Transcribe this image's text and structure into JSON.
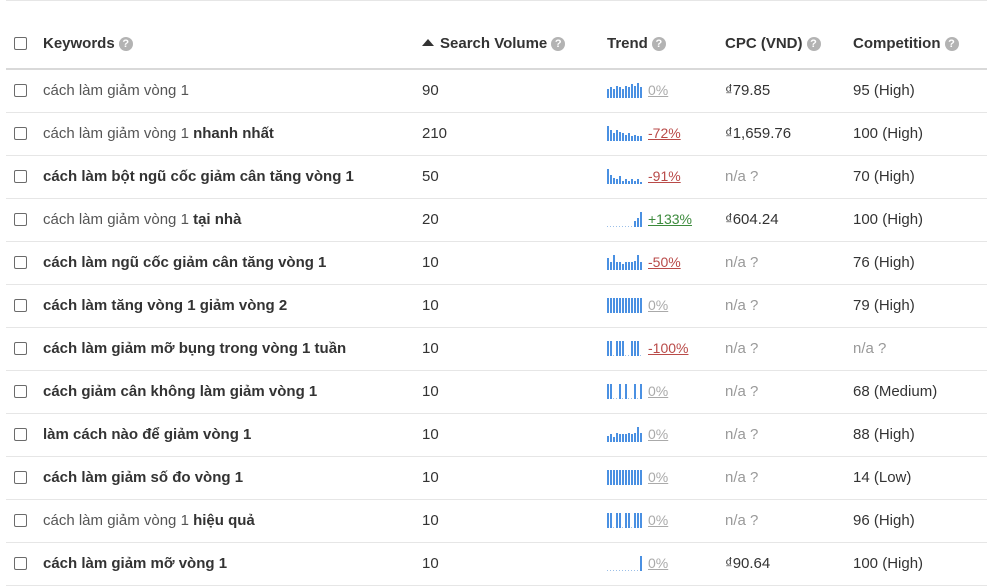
{
  "header": {
    "keywords": "Keywords",
    "search_volume": "Search Volume",
    "trend": "Trend",
    "cpc": "CPC (VND)",
    "competition": "Competition",
    "help_glyph": "?"
  },
  "colors": {
    "spark": "#4a90e2",
    "baseline": "#9bbfe8",
    "negative": "#b94a48",
    "positive": "#3c8a3c"
  },
  "rows": [
    {
      "kw_a": "cách làm giảm vòng 1",
      "kw_b": "",
      "bold_all": false,
      "volume": "90",
      "pct": "0%",
      "pct_kind": "neutral",
      "cpc": "₫79.85",
      "cpc_na": false,
      "comp": "95 (High)",
      "comp_na": false,
      "trend": [
        0.6,
        0.7,
        0.6,
        0.8,
        0.7,
        0.6,
        0.8,
        0.7,
        0.9,
        0.8,
        1.0,
        0.7
      ]
    },
    {
      "kw_a": "cách làm giảm vòng 1",
      "kw_b": "nhanh nhất",
      "bold_all": false,
      "volume": "210",
      "pct": "-72%",
      "pct_kind": "neg",
      "cpc": "₫1,659.76",
      "cpc_na": false,
      "comp": "100 (High)",
      "comp_na": false,
      "trend": [
        1.0,
        0.7,
        0.5,
        0.7,
        0.6,
        0.5,
        0.4,
        0.5,
        0.3,
        0.4,
        0.3,
        0.3
      ]
    },
    {
      "kw_a": "cách làm bột ngũ cốc giảm cân tăng vòng 1",
      "kw_b": "",
      "bold_all": true,
      "volume": "50",
      "pct": "-91%",
      "pct_kind": "neg",
      "cpc": "n/a ?",
      "cpc_na": true,
      "comp": "70 (High)",
      "comp_na": false,
      "trend": [
        1.0,
        0.6,
        0.4,
        0.3,
        0.5,
        0.2,
        0.3,
        0.2,
        0.3,
        0.2,
        0.3,
        0.1
      ]
    },
    {
      "kw_a": "cách làm giảm vòng 1",
      "kw_b": "tại nhà",
      "bold_all": false,
      "volume": "20",
      "pct": "+133%",
      "pct_kind": "pos",
      "cpc": "₫604.24",
      "cpc_na": false,
      "comp": "100 (High)",
      "comp_na": false,
      "trend": [
        0,
        0,
        0,
        0,
        0,
        0,
        0,
        0,
        0,
        0.4,
        0.6,
        1.0
      ]
    },
    {
      "kw_a": "cách làm ngũ cốc giảm cân tăng vòng 1",
      "kw_b": "",
      "bold_all": true,
      "volume": "10",
      "pct": "-50%",
      "pct_kind": "neg",
      "cpc": "n/a ?",
      "cpc_na": true,
      "comp": "76 (High)",
      "comp_na": false,
      "trend": [
        0.8,
        0.5,
        1.0,
        0.5,
        0.5,
        0.4,
        0.5,
        0.5,
        0.5,
        0.6,
        1.0,
        0.5
      ]
    },
    {
      "kw_a": "cách làm tăng vòng 1 giảm vòng 2",
      "kw_b": "",
      "bold_all": true,
      "volume": "10",
      "pct": "0%",
      "pct_kind": "neutral",
      "cpc": "n/a ?",
      "cpc_na": true,
      "comp": "79 (High)",
      "comp_na": false,
      "trend": [
        1.0,
        1.0,
        1.0,
        1.0,
        1.0,
        1.0,
        1.0,
        1.0,
        1.0,
        1.0,
        1.0,
        1.0
      ]
    },
    {
      "kw_a": "cách làm giảm mỡ bụng trong vòng 1 tuần",
      "kw_b": "",
      "bold_all": true,
      "volume": "10",
      "pct": "-100%",
      "pct_kind": "neg",
      "cpc": "n/a ?",
      "cpc_na": true,
      "comp": "n/a ?",
      "comp_na": true,
      "trend": [
        1.0,
        1.0,
        0,
        1.0,
        1.0,
        1.0,
        0,
        0,
        1.0,
        1.0,
        1.0,
        0
      ]
    },
    {
      "kw_a": "cách giảm cân không làm giảm vòng 1",
      "kw_b": "",
      "bold_all": true,
      "volume": "10",
      "pct": "0%",
      "pct_kind": "neutral",
      "cpc": "n/a ?",
      "cpc_na": true,
      "comp": "68 (Medium)",
      "comp_na": false,
      "trend": [
        1.0,
        1.0,
        0,
        0,
        1.0,
        0,
        1.0,
        0,
        0,
        1.0,
        0,
        1.0
      ]
    },
    {
      "kw_a": "làm cách nào để giảm vòng 1",
      "kw_b": "",
      "bold_all": true,
      "volume": "10",
      "pct": "0%",
      "pct_kind": "neutral",
      "cpc": "n/a ?",
      "cpc_na": true,
      "comp": "88 (High)",
      "comp_na": false,
      "trend": [
        0.4,
        0.5,
        0.3,
        0.6,
        0.5,
        0.5,
        0.5,
        0.6,
        0.5,
        0.6,
        1.0,
        0.6
      ]
    },
    {
      "kw_a": "cách làm giảm số đo vòng 1",
      "kw_b": "",
      "bold_all": true,
      "volume": "10",
      "pct": "0%",
      "pct_kind": "neutral",
      "cpc": "n/a ?",
      "cpc_na": true,
      "comp": "14 (Low)",
      "comp_na": false,
      "trend": [
        1.0,
        1.0,
        1.0,
        1.0,
        1.0,
        1.0,
        1.0,
        1.0,
        1.0,
        1.0,
        1.0,
        1.0
      ]
    },
    {
      "kw_a": "cách làm giảm vòng 1",
      "kw_b": "hiệu quả",
      "bold_all": false,
      "volume": "10",
      "pct": "0%",
      "pct_kind": "neutral",
      "cpc": "n/a ?",
      "cpc_na": true,
      "comp": "96 (High)",
      "comp_na": false,
      "trend": [
        1.0,
        1.0,
        0,
        1.0,
        1.0,
        0,
        1.0,
        1.0,
        0,
        1.0,
        1.0,
        1.0
      ]
    },
    {
      "kw_a": "cách làm giảm mỡ vòng 1",
      "kw_b": "",
      "bold_all": true,
      "volume": "10",
      "pct": "0%",
      "pct_kind": "neutral",
      "cpc": "₫90.64",
      "cpc_na": false,
      "comp": "100 (High)",
      "comp_na": false,
      "trend": [
        0,
        0,
        0,
        0,
        0,
        0,
        0,
        0,
        0,
        0,
        0,
        1.0
      ]
    }
  ]
}
